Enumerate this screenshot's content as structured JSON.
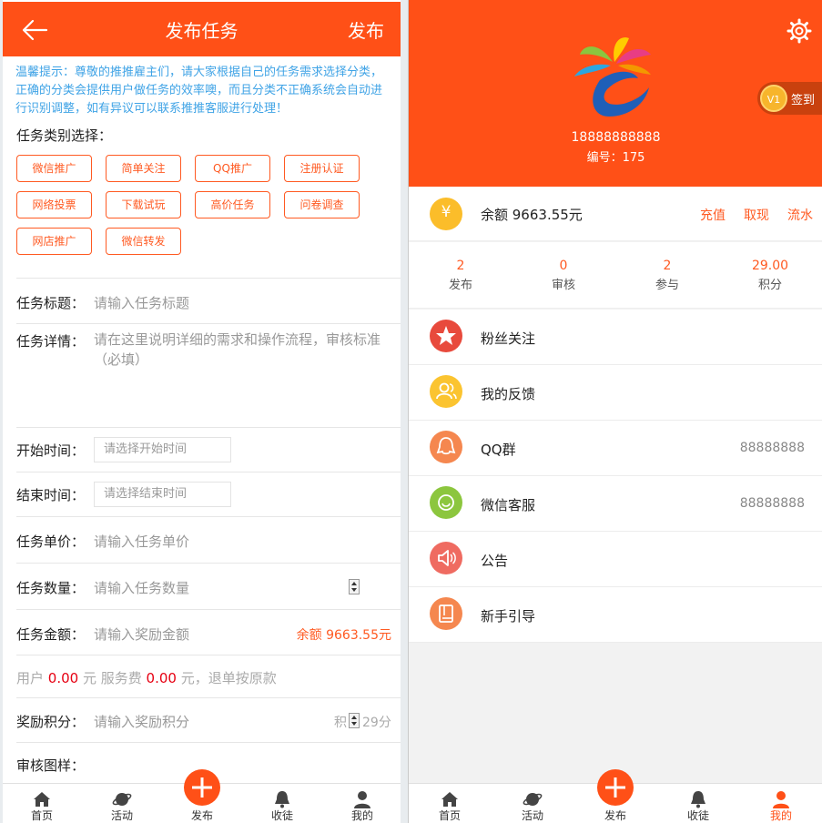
{
  "left": {
    "header": {
      "title": "发布任务",
      "publish": "发布"
    },
    "tip": "温馨提示：尊敬的推推雇主们，请大家根据自己的任务需求选择分类，正确的分类会提供用户做任务的效率噢，而且分类不正确系统会自动进行识别调整，如有异议可以联系推推客服进行处理！",
    "category_label": "任务类别选择：",
    "categories": [
      "微信推广",
      "简单关注",
      "QQ推广",
      "注册认证",
      "网络投票",
      "下载试玩",
      "高价任务",
      "问卷调查",
      "网店推广",
      "微信转发"
    ],
    "form": {
      "title_label": "任务标题：",
      "title_placeholder": "请输入任务标题",
      "detail_label": "任务详情：",
      "detail_placeholder": "请在这里说明详细的需求和操作流程，审核标准（必填）",
      "start_label": "开始时间：",
      "start_placeholder": "请选择开始时间",
      "end_label": "结束时间：",
      "end_placeholder": "请选择结束时间",
      "price_label": "任务单价：",
      "price_placeholder": "请输入任务单价",
      "qty_label": "任务数量：",
      "qty_placeholder": "请输入任务数量",
      "amount_label": "任务金额：",
      "amount_placeholder": "请输入奖励金额",
      "balance_text": "余额 9663.55元",
      "fee_prefix": "用户",
      "fee_user": "0.00",
      "fee_mid": "元 服务费",
      "fee_service": "0.00",
      "fee_suffix": "元，退单按原款",
      "points_label": "奖励积分：",
      "points_placeholder": "请输入奖励积分",
      "points_suffix_a": "积",
      "points_suffix_b": "29分",
      "sample_label": "审核图样："
    }
  },
  "tabbar": {
    "home": "首页",
    "activity": "活动",
    "publish": "发布",
    "collect": "收徒",
    "mine": "我的"
  },
  "right": {
    "phone": "18888888888",
    "uid": "编号：175",
    "signin": {
      "level": "V1",
      "label": "签到"
    },
    "balance": {
      "text": "余额 9663.55元",
      "recharge": "充值",
      "withdraw": "取现",
      "flow": "流水"
    },
    "stats": [
      {
        "num": "2",
        "label": "发布"
      },
      {
        "num": "0",
        "label": "审核"
      },
      {
        "num": "2",
        "label": "参与"
      },
      {
        "num": "29.00",
        "label": "积分"
      }
    ],
    "menu": [
      {
        "label": "粉丝关注",
        "value": ""
      },
      {
        "label": "我的反馈",
        "value": ""
      },
      {
        "label": "QQ群",
        "value": "88888888"
      },
      {
        "label": "微信客服",
        "value": "88888888"
      },
      {
        "label": "公告",
        "value": ""
      },
      {
        "label": "新手引导",
        "value": ""
      }
    ]
  },
  "colors": {
    "brand": "#ff5017",
    "accent_text": "#ff5a22",
    "tip_blue": "#3fa3e6",
    "money_red": "#e60012"
  }
}
